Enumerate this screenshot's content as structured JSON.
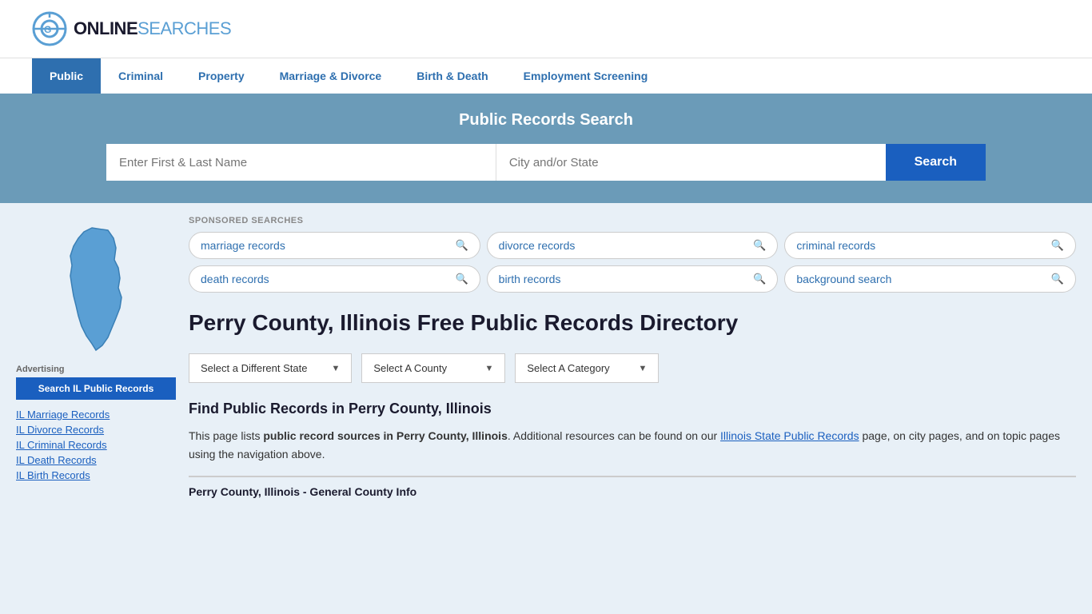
{
  "logo": {
    "text_online": "ONLINE",
    "text_searches": "SEARCHES",
    "icon_label": "OnlineSearches logo"
  },
  "nav": {
    "items": [
      {
        "label": "Public",
        "active": true
      },
      {
        "label": "Criminal",
        "active": false
      },
      {
        "label": "Property",
        "active": false
      },
      {
        "label": "Marriage & Divorce",
        "active": false
      },
      {
        "label": "Birth & Death",
        "active": false
      },
      {
        "label": "Employment Screening",
        "active": false
      }
    ]
  },
  "search_banner": {
    "title": "Public Records Search",
    "name_placeholder": "Enter First & Last Name",
    "location_placeholder": "City and/or State",
    "button_label": "Search"
  },
  "sponsored": {
    "label": "SPONSORED SEARCHES",
    "tags": [
      {
        "label": "marriage records"
      },
      {
        "label": "divorce records"
      },
      {
        "label": "criminal records"
      },
      {
        "label": "death records"
      },
      {
        "label": "birth records"
      },
      {
        "label": "background search"
      }
    ]
  },
  "page": {
    "title": "Perry County, Illinois Free Public Records Directory",
    "dropdowns": {
      "state_label": "Select a Different State",
      "county_label": "Select A County",
      "category_label": "Select A Category"
    },
    "find_title": "Find Public Records in Perry County, Illinois",
    "find_desc_start": "This page lists ",
    "find_desc_bold": "public record sources in Perry County, Illinois",
    "find_desc_mid": ". Additional resources can be found on our ",
    "find_desc_link": "Illinois State Public Records",
    "find_desc_end": " page, on city pages, and on topic pages using the navigation above.",
    "county_info_title": "Perry County, Illinois - General County Info"
  },
  "sidebar": {
    "ad_label": "Advertising",
    "ad_btn_label": "Search IL Public Records",
    "links": [
      {
        "label": "IL Marriage Records"
      },
      {
        "label": "IL Divorce Records"
      },
      {
        "label": "IL Criminal Records"
      },
      {
        "label": "IL Death Records"
      },
      {
        "label": "IL Birth Records"
      }
    ]
  }
}
